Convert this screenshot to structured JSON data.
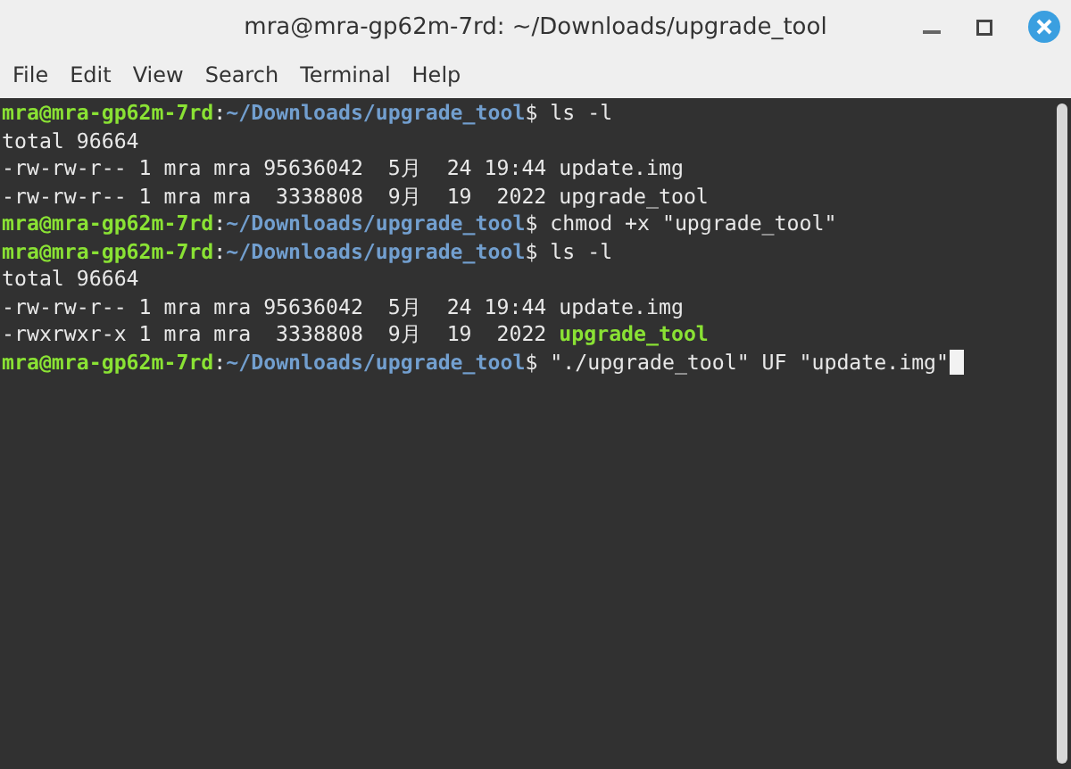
{
  "window": {
    "title": "mra@mra-gp62m-7rd: ~/Downloads/upgrade_tool"
  },
  "menu": [
    "File",
    "Edit",
    "View",
    "Search",
    "Terminal",
    "Help"
  ],
  "terminal": {
    "lines": [
      {
        "cursor": false,
        "segments": [
          {
            "kind": "user",
            "text": "mra@mra-gp62m-7rd"
          },
          {
            "kind": "plain",
            "text": ":"
          },
          {
            "kind": "path",
            "text": "~/Downloads/upgrade_tool"
          },
          {
            "kind": "plain",
            "text": "$ ls -l"
          }
        ]
      },
      {
        "cursor": false,
        "segments": [
          {
            "kind": "plain",
            "text": "total 96664"
          }
        ]
      },
      {
        "cursor": false,
        "segments": [
          {
            "kind": "plain",
            "text": "-rw-rw-r-- 1 mra mra 95636042  5月  24 19:44 update.img"
          }
        ]
      },
      {
        "cursor": false,
        "segments": [
          {
            "kind": "plain",
            "text": "-rw-rw-r-- 1 mra mra  3338808  9月  19  2022 upgrade_tool"
          }
        ]
      },
      {
        "cursor": false,
        "segments": [
          {
            "kind": "user",
            "text": "mra@mra-gp62m-7rd"
          },
          {
            "kind": "plain",
            "text": ":"
          },
          {
            "kind": "path",
            "text": "~/Downloads/upgrade_tool"
          },
          {
            "kind": "plain",
            "text": "$ chmod +x \"upgrade_tool\""
          }
        ]
      },
      {
        "cursor": false,
        "segments": [
          {
            "kind": "user",
            "text": "mra@mra-gp62m-7rd"
          },
          {
            "kind": "plain",
            "text": ":"
          },
          {
            "kind": "path",
            "text": "~/Downloads/upgrade_tool"
          },
          {
            "kind": "plain",
            "text": "$ ls -l"
          }
        ]
      },
      {
        "cursor": false,
        "segments": [
          {
            "kind": "plain",
            "text": "total 96664"
          }
        ]
      },
      {
        "cursor": false,
        "segments": [
          {
            "kind": "plain",
            "text": "-rw-rw-r-- 1 mra mra 95636042  5月  24 19:44 update.img"
          }
        ]
      },
      {
        "cursor": false,
        "segments": [
          {
            "kind": "plain",
            "text": "-rwxrwxr-x 1 mra mra  3338808  9月  19  2022 "
          },
          {
            "kind": "exec",
            "text": "upgrade_tool"
          }
        ]
      },
      {
        "cursor": true,
        "segments": [
          {
            "kind": "user",
            "text": "mra@mra-gp62m-7rd"
          },
          {
            "kind": "plain",
            "text": ":"
          },
          {
            "kind": "path",
            "text": "~/Downloads/upgrade_tool"
          },
          {
            "kind": "plain",
            "text": "$ \"./upgrade_tool\" UF \"update.img\""
          }
        ]
      }
    ]
  }
}
